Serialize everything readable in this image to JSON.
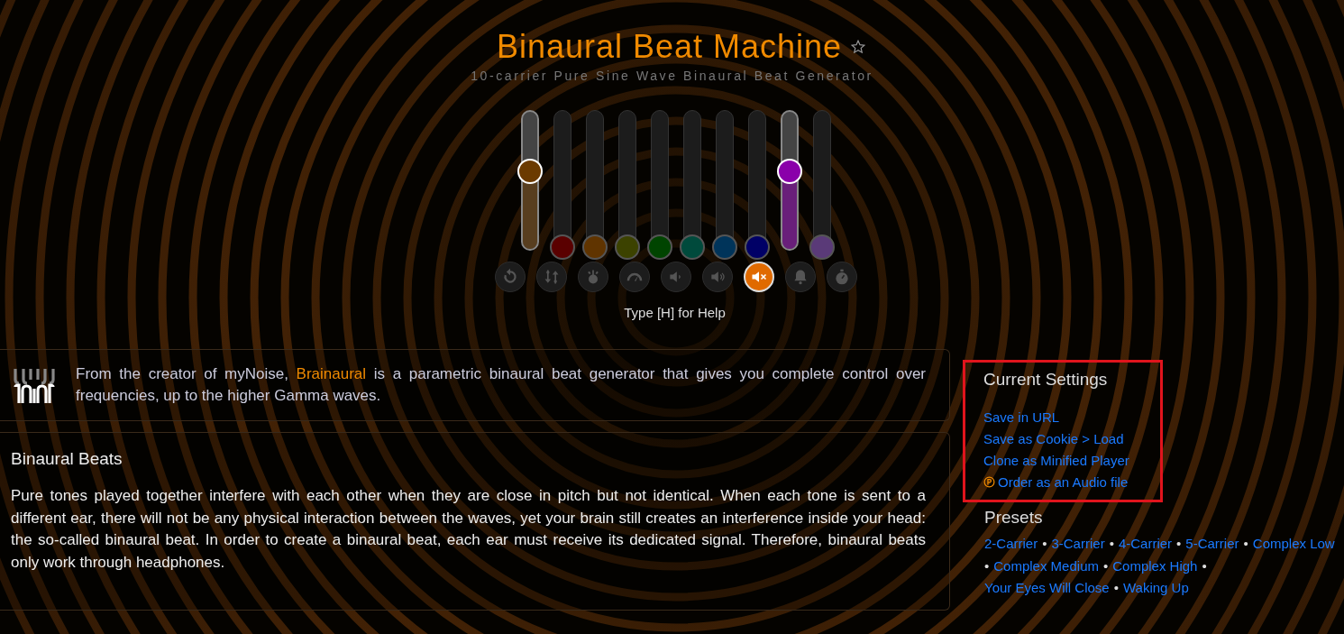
{
  "header": {
    "title": "Binaural Beat Machine",
    "favorite": false,
    "subtitle": "10-carrier Pure Sine Wave Binaural Beat Generator"
  },
  "sliders": [
    {
      "color": "#6b3a00",
      "level": 0.61
    },
    {
      "color": "#5a0000",
      "level": 0
    },
    {
      "color": "#603400",
      "level": 0
    },
    {
      "color": "#3c4200",
      "level": 0
    },
    {
      "color": "#004400",
      "level": 0
    },
    {
      "color": "#004a3c",
      "level": 0
    },
    {
      "color": "#00345a",
      "level": 0
    },
    {
      "color": "#000066",
      "level": 0
    },
    {
      "color": "#8a00aa",
      "level": 0.61
    },
    {
      "color": "#5a3a78",
      "level": 0
    }
  ],
  "controls": [
    {
      "kind": "reset",
      "selected": false
    },
    {
      "kind": "shuffle",
      "selected": false
    },
    {
      "kind": "power",
      "selected": false
    },
    {
      "kind": "gauge",
      "selected": false
    },
    {
      "kind": "volume-low",
      "selected": false
    },
    {
      "kind": "volume-high",
      "selected": false
    },
    {
      "kind": "mute",
      "selected": true
    },
    {
      "kind": "bell",
      "selected": false
    },
    {
      "kind": "timer",
      "selected": false
    }
  ],
  "help": "Type [H] for Help",
  "intro": {
    "before": "From the creator of myNoise,",
    "link": "Brainaural",
    "after": "is a parametric binaural beat generator that gives you complete control over frequencies, up to the higher Gamma waves."
  },
  "article": {
    "heading": "Binaural Beats",
    "body": "Pure tones played together interfere with each other when they are close in pitch but not identical. When each tone is sent to a different ear, there will not be any physical interaction between the waves, yet your brain still creates an interference inside your head: the so-called binaural beat. In order to create a binaural beat, each ear must receive its dedicated signal. Therefore, binaural beats only work through headphones."
  },
  "current_settings": {
    "heading": "Current Settings",
    "highlighted": true,
    "links": [
      {
        "label": "Save in URL",
        "paid": false
      },
      {
        "label": "Save as Cookie > Load",
        "paid": false
      },
      {
        "label": "Clone as Minified Player",
        "paid": false
      },
      {
        "label": "Order as an Audio file",
        "paid": true
      }
    ]
  },
  "presets": {
    "heading": "Presets",
    "separator": "•",
    "items": [
      "2-Carrier",
      "3-Carrier",
      "4-Carrier",
      "5-Carrier",
      "Complex Low",
      "Complex Medium",
      "Complex High",
      "Your Eyes Will Close",
      "Waking Up"
    ]
  }
}
